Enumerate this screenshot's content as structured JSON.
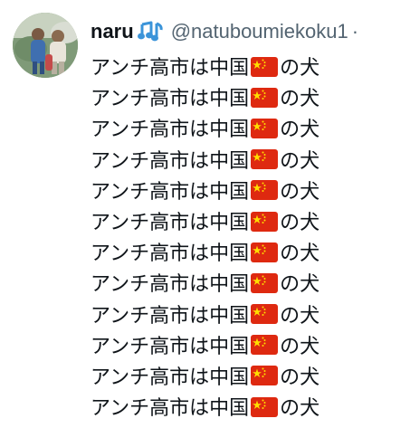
{
  "tweet": {
    "display_name": "naru",
    "name_emoji_icon": "musical-notes-icon",
    "handle": "@natuboumiekoku1",
    "separator": "·",
    "lines": [
      {
        "before": "アンチ高市は中国",
        "flag_icon": "china-flag-icon",
        "after": "の犬"
      },
      {
        "before": "アンチ高市は中国",
        "flag_icon": "china-flag-icon",
        "after": "の犬"
      },
      {
        "before": "アンチ高市は中国",
        "flag_icon": "china-flag-icon",
        "after": "の犬"
      },
      {
        "before": "アンチ高市は中国",
        "flag_icon": "china-flag-icon",
        "after": "の犬"
      },
      {
        "before": "アンチ高市は中国",
        "flag_icon": "china-flag-icon",
        "after": "の犬"
      },
      {
        "before": "アンチ高市は中国",
        "flag_icon": "china-flag-icon",
        "after": "の犬"
      },
      {
        "before": "アンチ高市は中国",
        "flag_icon": "china-flag-icon",
        "after": "の犬"
      },
      {
        "before": "アンチ高市は中国",
        "flag_icon": "china-flag-icon",
        "after": "の犬"
      },
      {
        "before": "アンチ高市は中国",
        "flag_icon": "china-flag-icon",
        "after": "の犬"
      },
      {
        "before": "アンチ高市は中国",
        "flag_icon": "china-flag-icon",
        "after": "の犬"
      },
      {
        "before": "アンチ高市は中国",
        "flag_icon": "china-flag-icon",
        "after": "の犬"
      },
      {
        "before": "アンチ高市は中国",
        "flag_icon": "china-flag-icon",
        "after": "の犬"
      }
    ]
  },
  "colors": {
    "text": "#0f1419",
    "secondary_text": "#536471",
    "note_blue": "#3b94d9",
    "flag_red": "#de2910",
    "flag_yellow": "#ffde00"
  }
}
